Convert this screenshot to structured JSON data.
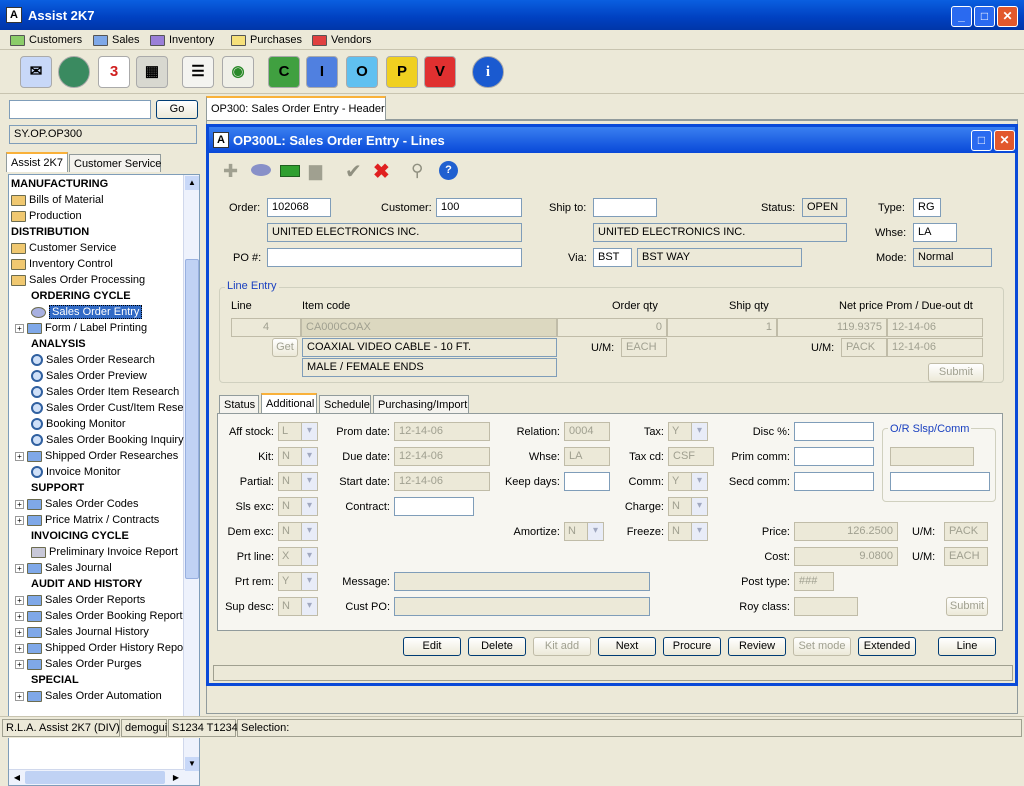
{
  "app": {
    "title": "Assist 2K7"
  },
  "menu": [
    "Customers",
    "Sales",
    "Inventory",
    "Purchases",
    "Vendors"
  ],
  "toolbar_letters": [
    "C",
    "I",
    "O",
    "P",
    "V"
  ],
  "left": {
    "go_label": "Go",
    "path": "SY.OP.OP300",
    "tabs": [
      "Assist 2K7",
      "Customer Service"
    ],
    "tree": [
      {
        "t": "MANUFACTURING",
        "k": "hdr",
        "x": 2
      },
      {
        "t": "Bills of Material",
        "k": "fold",
        "x": 2
      },
      {
        "t": "Production",
        "k": "fold",
        "x": 2
      },
      {
        "t": "DISTRIBUTION",
        "k": "hdr",
        "x": 2
      },
      {
        "t": "Customer Service",
        "k": "fold",
        "x": 2
      },
      {
        "t": "Inventory Control",
        "k": "fold",
        "x": 2
      },
      {
        "t": "Sales Order Processing",
        "k": "fold",
        "x": 2
      },
      {
        "t": "ORDERING CYCLE",
        "k": "hdr",
        "x": 22
      },
      {
        "t": "Sales Order Entry",
        "k": "sel",
        "x": 22
      },
      {
        "t": "Form / Label Printing",
        "k": "expfold",
        "x": 6
      },
      {
        "t": "ANALYSIS",
        "k": "hdr",
        "x": 22
      },
      {
        "t": "Sales Order Research",
        "k": "mag",
        "x": 22
      },
      {
        "t": "Sales Order Preview",
        "k": "mag",
        "x": 22
      },
      {
        "t": "Sales Order Item Research",
        "k": "mag",
        "x": 22
      },
      {
        "t": "Sales Order Cust/Item Rese",
        "k": "mag",
        "x": 22
      },
      {
        "t": "Booking Monitor",
        "k": "mag",
        "x": 22
      },
      {
        "t": "Sales Order Booking Inquiry",
        "k": "mag",
        "x": 22
      },
      {
        "t": "Shipped Order Researches",
        "k": "expfold",
        "x": 6
      },
      {
        "t": "Invoice Monitor",
        "k": "mag",
        "x": 22
      },
      {
        "t": "SUPPORT",
        "k": "hdr",
        "x": 22
      },
      {
        "t": "Sales Order Codes",
        "k": "expfold",
        "x": 6
      },
      {
        "t": "Price Matrix / Contracts",
        "k": "expfold",
        "x": 6
      },
      {
        "t": "INVOICING CYCLE",
        "k": "hdr",
        "x": 22
      },
      {
        "t": "Preliminary Invoice Report",
        "k": "print",
        "x": 22
      },
      {
        "t": "Sales Journal",
        "k": "expfold",
        "x": 6
      },
      {
        "t": "AUDIT AND HISTORY",
        "k": "hdr",
        "x": 22
      },
      {
        "t": "Sales Order Reports",
        "k": "expfold",
        "x": 6
      },
      {
        "t": "Sales Order Booking Report",
        "k": "expfold",
        "x": 6
      },
      {
        "t": "Sales Journal History",
        "k": "expfold",
        "x": 6
      },
      {
        "t": "Shipped Order History Repo",
        "k": "expfold",
        "x": 6
      },
      {
        "t": "Sales Order Purges",
        "k": "expfold",
        "x": 6
      },
      {
        "t": "SPECIAL",
        "k": "hdr",
        "x": 22
      },
      {
        "t": "Sales Order Automation",
        "k": "expfold",
        "x": 6
      }
    ]
  },
  "outer_tab": "OP300: Sales Order Entry - Header",
  "inner": {
    "title": "OP300L: Sales Order Entry - Lines"
  },
  "header": {
    "order_label": "Order:",
    "order": "102068",
    "customer_label": "Customer:",
    "customer": "100",
    "customer_name": "UNITED ELECTRONICS INC.",
    "shipto_label": "Ship to:",
    "shipto": "",
    "shipto_name": "UNITED ELECTRONICS INC.",
    "status_label": "Status:",
    "status": "OPEN",
    "type_label": "Type:",
    "type": "RG",
    "whse_label": "Whse:",
    "whse": "LA",
    "po_label": "PO #:",
    "po": "",
    "via_label": "Via:",
    "via_code": "BST",
    "via_name": "BST WAY",
    "mode_label": "Mode:",
    "mode": "Normal"
  },
  "line_entry": {
    "legend": "Line Entry",
    "cols": {
      "line": "Line",
      "item": "Item code",
      "order_qty": "Order qty",
      "ship_qty": "Ship qty",
      "net_price": "Net price",
      "due": "Prom / Due-out dt"
    },
    "line": "4",
    "item": "CA000COAX",
    "order_qty": "0",
    "ship_qty": "1",
    "net_price": "119.9375",
    "due": "12-14-06",
    "get_label": "Get",
    "desc1": "COAXIAL VIDEO CABLE - 10 FT.",
    "desc2": "MALE / FEMALE ENDS",
    "um_label": "U/M:",
    "um1": "EACH",
    "um2": "PACK",
    "due2": "12-14-06",
    "submit": "Submit"
  },
  "tabs": [
    "Status",
    "Additional",
    "Schedule",
    "Purchasing/Import"
  ],
  "additional": {
    "aff_stock": {
      "label": "Aff stock:",
      "value": "L"
    },
    "kit": {
      "label": "Kit:",
      "value": "N"
    },
    "partial": {
      "label": "Partial:",
      "value": "N"
    },
    "sls_exc": {
      "label": "Sls exc:",
      "value": "N"
    },
    "dem_exc": {
      "label": "Dem exc:",
      "value": "N"
    },
    "prt_line": {
      "label": "Prt line:",
      "value": "X"
    },
    "prt_rem": {
      "label": "Prt rem:",
      "value": "Y"
    },
    "sup_desc": {
      "label": "Sup desc:",
      "value": "N"
    },
    "prom_date": {
      "label": "Prom date:",
      "value": "12-14-06"
    },
    "due_date": {
      "label": "Due date:",
      "value": "12-14-06"
    },
    "start_date": {
      "label": "Start date:",
      "value": "12-14-06"
    },
    "contract": {
      "label": "Contract:",
      "value": ""
    },
    "message": {
      "label": "Message:",
      "value": ""
    },
    "cust_po": {
      "label": "Cust PO:",
      "value": ""
    },
    "relation": {
      "label": "Relation:",
      "value": "0004"
    },
    "whse": {
      "label": "Whse:",
      "value": "LA"
    },
    "keep_days": {
      "label": "Keep days:",
      "value": ""
    },
    "amortize": {
      "label": "Amortize:",
      "value": "N"
    },
    "tax": {
      "label": "Tax:",
      "value": "Y"
    },
    "tax_cd": {
      "label": "Tax cd:",
      "value": "CSF"
    },
    "comm": {
      "label": "Comm:",
      "value": "Y"
    },
    "charge": {
      "label": "Charge:",
      "value": "N"
    },
    "freeze": {
      "label": "Freeze:",
      "value": "N"
    },
    "disc": {
      "label": "Disc %:",
      "value": ""
    },
    "prim_comm": {
      "label": "Prim comm:",
      "value": ""
    },
    "secd_comm": {
      "label": "Secd comm:",
      "value": ""
    },
    "price": {
      "label": "Price:",
      "value": "126.2500"
    },
    "cost": {
      "label": "Cost:",
      "value": "9.0800"
    },
    "post_type": {
      "label": "Post type:",
      "value": "###"
    },
    "roy_class": {
      "label": "Roy class:",
      "value": ""
    },
    "um_label": "U/M:",
    "price_um": "PACK",
    "cost_um": "EACH",
    "slsp_legend": "O/R Slsp/Comm",
    "submit": "Submit"
  },
  "buttons": [
    "Edit",
    "Delete",
    "Kit add",
    "Next",
    "Procure",
    "Review",
    "Set mode",
    "Extended",
    "Line"
  ],
  "statusbar": [
    "R.L.A. Assist 2K7 (DIV)",
    "demogui",
    "S1234 T1234",
    "Selection:"
  ]
}
